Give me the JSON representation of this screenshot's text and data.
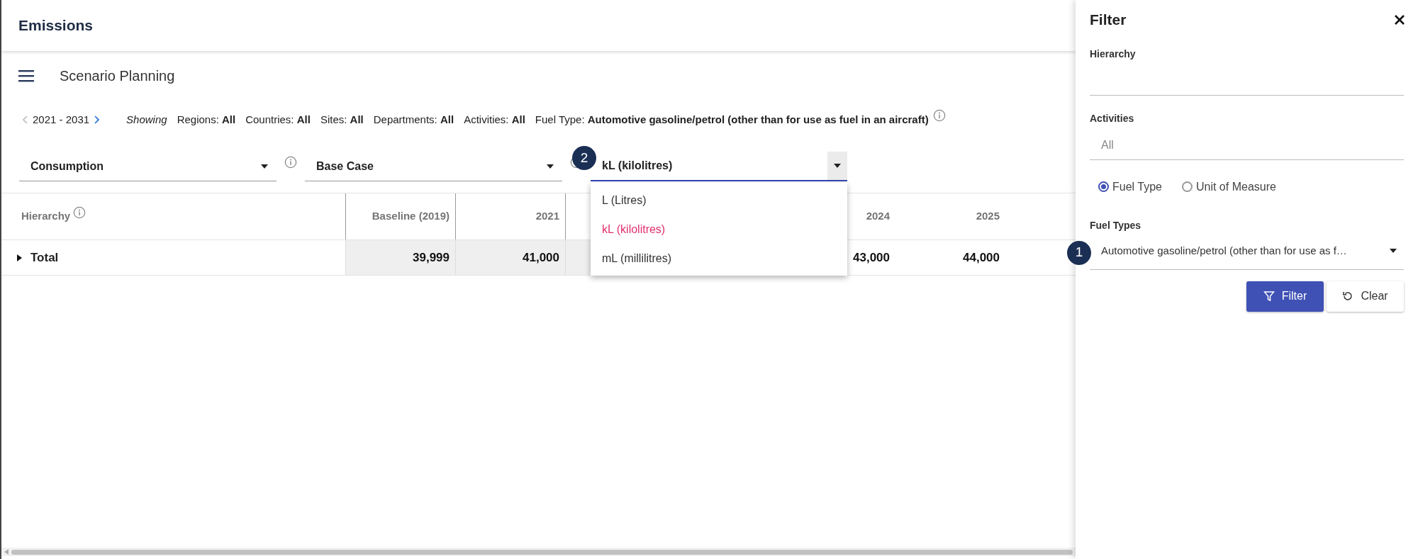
{
  "header": {
    "title": "Emissions"
  },
  "toolbar": {
    "title": "Scenario Planning"
  },
  "period": {
    "range": "2021 - 2031",
    "prev_disabled": true,
    "next_disabled": false
  },
  "showing_label": "Showing",
  "filters": [
    {
      "label": "Regions:",
      "value": "All"
    },
    {
      "label": "Countries:",
      "value": "All"
    },
    {
      "label": "Sites:",
      "value": "All"
    },
    {
      "label": "Departments:",
      "value": "All"
    },
    {
      "label": "Activities:",
      "value": "All"
    },
    {
      "label": "Fuel Type:",
      "value": "Automotive gasoline/petrol (other than for use as fuel in an aircraft)"
    }
  ],
  "selects": [
    {
      "value": "Consumption"
    },
    {
      "value": "Base Case"
    }
  ],
  "unit_select": {
    "value": "kL (kilolitres)",
    "badge": "2",
    "expanded": true,
    "options": [
      {
        "label": "L (Litres)",
        "selected": false
      },
      {
        "label": "kL (kilolitres)",
        "selected": true
      },
      {
        "label": "mL (millilitres)",
        "selected": false
      }
    ]
  },
  "table": {
    "columns": [
      {
        "label": "Hierarchy",
        "shaded": false
      },
      {
        "label": "Baseline (2019)",
        "shaded": true
      },
      {
        "label": "2021",
        "shaded": true
      },
      {
        "label": "2024",
        "shaded": false
      },
      {
        "label": "2025",
        "shaded": false
      }
    ],
    "rows": [
      {
        "expanded": false,
        "cells": [
          "Total",
          "39,999",
          "41,000",
          "43,000",
          "44,000"
        ]
      }
    ]
  },
  "panel": {
    "title": "Filter",
    "fields": [
      {
        "label": "Hierarchy"
      },
      {
        "label": "Activities",
        "placeholder": "All"
      }
    ],
    "mode_options": [
      {
        "label": "Fuel Type",
        "selected": true
      },
      {
        "label": "Unit of Measure",
        "selected": false
      }
    ],
    "fuel_types": {
      "label": "Fuel Types",
      "value": "Automotive gasoline/petrol (other than for use as f…",
      "badge": "1"
    },
    "buttons": [
      {
        "kind": "primary",
        "label": "Filter"
      },
      {
        "kind": "secondary",
        "label": "Clear"
      }
    ]
  }
}
